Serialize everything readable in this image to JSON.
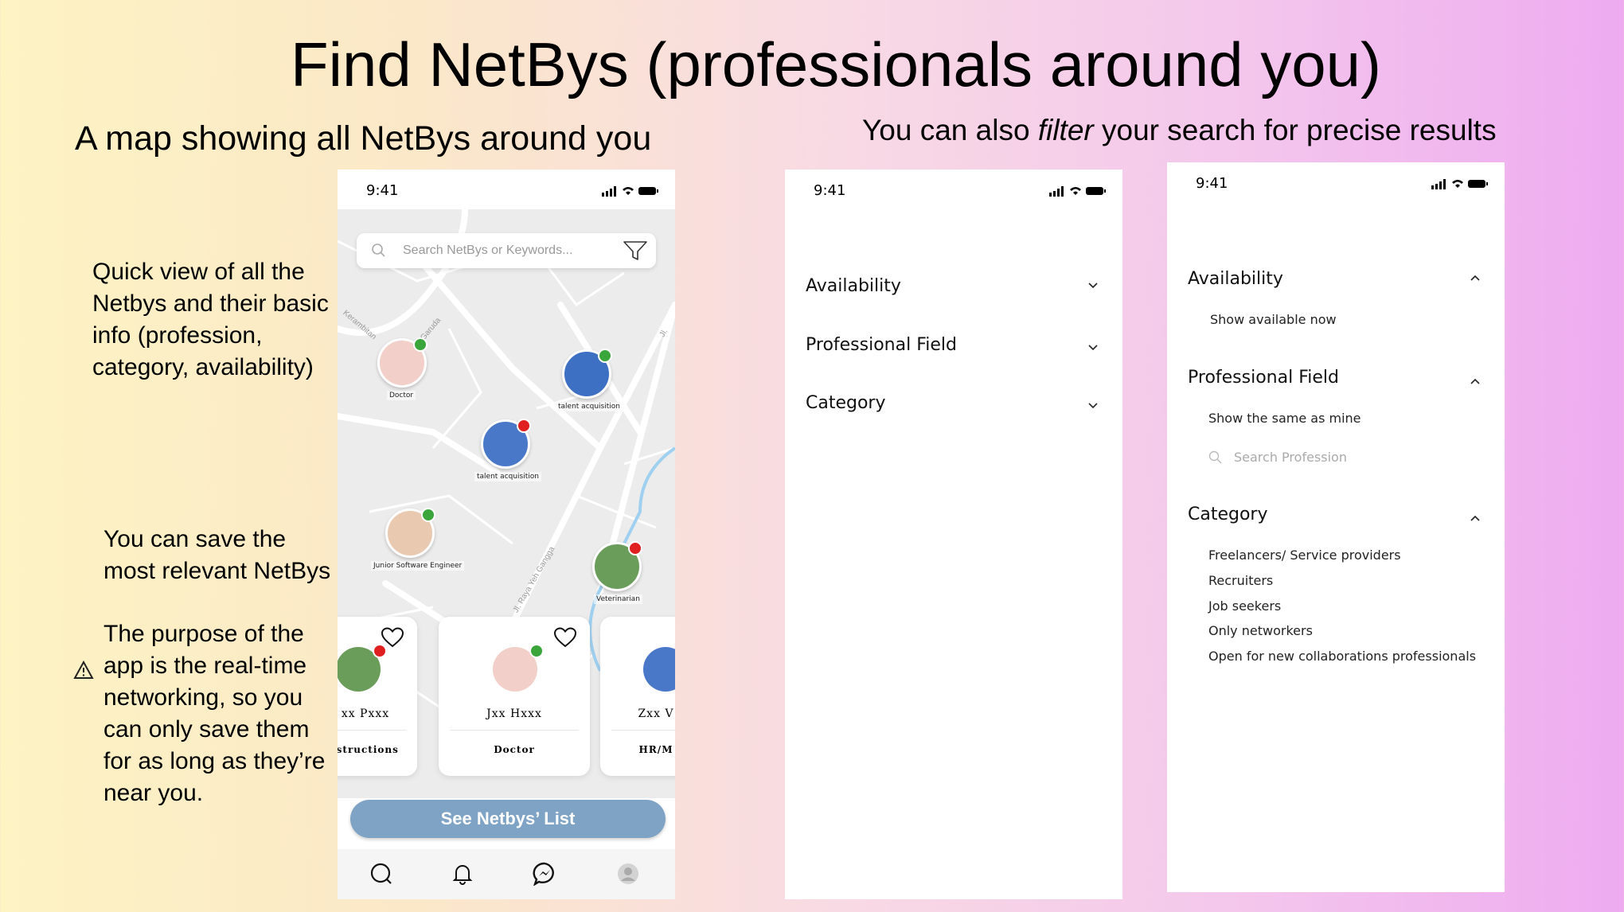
{
  "slide": {
    "title": "Find NetBys (professionals around you)",
    "left_heading": "A map showing all NetBys around you",
    "right_heading_before": "You can also ",
    "right_heading_em": "filter",
    "right_heading_after": " your search for precise results",
    "note_quick_view": "Quick view of all the Netbys and their basic info (profession, category, availability)",
    "note_save": "You can save the most relevant NetBys",
    "note_purpose": "The purpose of the app is the real-time networking, so you can only save them for as long as they’re near you."
  },
  "status_bar": {
    "time": "9:41"
  },
  "map_screen": {
    "search_placeholder": "Search NetBys or Keywords...",
    "roads": [
      "Kerambitan",
      "Jl. Garuda",
      "Jl. Raya Yeh Gangga",
      "Jl."
    ],
    "pins": [
      {
        "label": "Doctor",
        "status": "available"
      },
      {
        "label": "talent acquisition",
        "status": "available"
      },
      {
        "label": "talent acquisition",
        "status": "busy"
      },
      {
        "label": "Junior Software Engineer",
        "status": "available"
      },
      {
        "label": "Veterinarian",
        "status": "busy"
      }
    ],
    "cards": [
      {
        "name": "xx Pxxx",
        "profession": "istructions",
        "status": "busy"
      },
      {
        "name": "Jxx Hxxx",
        "profession": "Doctor",
        "status": "available"
      },
      {
        "name": "Zxx V",
        "profession": "HR/M",
        "status": "busy"
      }
    ],
    "cta": "See Netbys’ List",
    "tabs": [
      "search-icon",
      "bell-icon",
      "messenger-icon",
      "profile-icon"
    ]
  },
  "filter_collapsed": {
    "sections": [
      "Availability",
      "Professional Field",
      "Category"
    ]
  },
  "filter_expanded": {
    "availability": {
      "title": "Availability",
      "option": "Show available now"
    },
    "professional_field": {
      "title": "Professional Field",
      "option": "Show the same as mine",
      "search_placeholder": "Search Profession"
    },
    "category": {
      "title": "Category",
      "options": [
        "Freelancers/ Service providers",
        "Recruiters",
        "Job seekers",
        "Only networkers",
        "Open for new collaborations professionals"
      ]
    }
  },
  "colors": {
    "available": "#3aa53a",
    "busy": "#e02020",
    "cta": "#7ea3c4"
  }
}
